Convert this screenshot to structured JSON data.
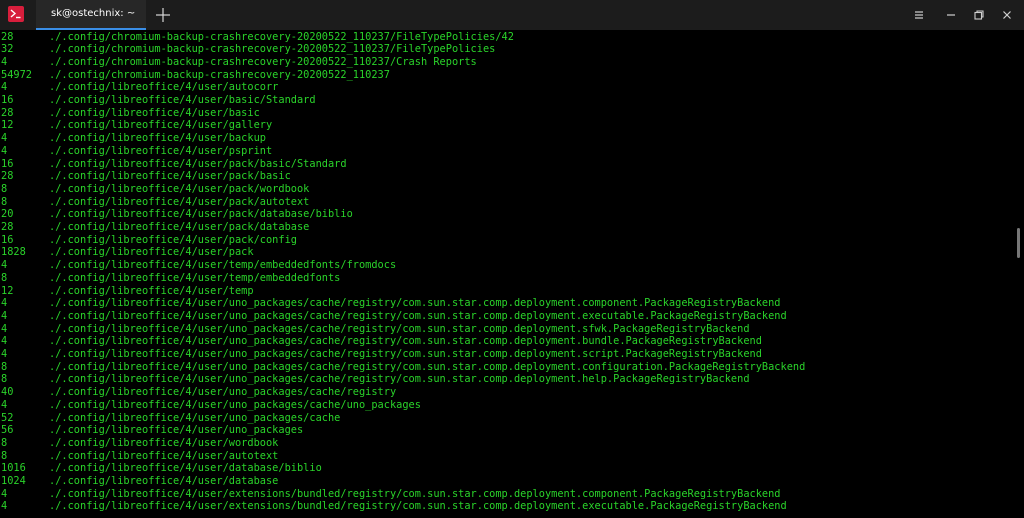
{
  "window": {
    "tab_title": "sk@ostechnix: ~",
    "icons": {
      "app": "terminal-icon",
      "new_tab": "plus-icon",
      "menu": "hamburger-menu-icon",
      "minimize": "minimize-icon",
      "maximize": "maximize-icon",
      "close": "close-icon"
    },
    "colors": {
      "titlebar": "#1c1c1c",
      "tab_active": "#272727",
      "tab_accent": "#3a8ee6",
      "app_icon": "#d71e3c",
      "terminal_bg": "#000000",
      "terminal_text": "#2ad32a"
    }
  },
  "terminal": {
    "lines": [
      {
        "size": "28",
        "path": "./.config/chromium-backup-crashrecovery-20200522_110237/FileTypePolicies/42"
      },
      {
        "size": "32",
        "path": "./.config/chromium-backup-crashrecovery-20200522_110237/FileTypePolicies"
      },
      {
        "size": "4",
        "path": "./.config/chromium-backup-crashrecovery-20200522_110237/Crash Reports"
      },
      {
        "size": "54972",
        "path": "./.config/chromium-backup-crashrecovery-20200522_110237"
      },
      {
        "size": "4",
        "path": "./.config/libreoffice/4/user/autocorr"
      },
      {
        "size": "16",
        "path": "./.config/libreoffice/4/user/basic/Standard"
      },
      {
        "size": "28",
        "path": "./.config/libreoffice/4/user/basic"
      },
      {
        "size": "12",
        "path": "./.config/libreoffice/4/user/gallery"
      },
      {
        "size": "4",
        "path": "./.config/libreoffice/4/user/backup"
      },
      {
        "size": "4",
        "path": "./.config/libreoffice/4/user/psprint"
      },
      {
        "size": "16",
        "path": "./.config/libreoffice/4/user/pack/basic/Standard"
      },
      {
        "size": "28",
        "path": "./.config/libreoffice/4/user/pack/basic"
      },
      {
        "size": "8",
        "path": "./.config/libreoffice/4/user/pack/wordbook"
      },
      {
        "size": "8",
        "path": "./.config/libreoffice/4/user/pack/autotext"
      },
      {
        "size": "20",
        "path": "./.config/libreoffice/4/user/pack/database/biblio"
      },
      {
        "size": "28",
        "path": "./.config/libreoffice/4/user/pack/database"
      },
      {
        "size": "16",
        "path": "./.config/libreoffice/4/user/pack/config"
      },
      {
        "size": "1828",
        "path": "./.config/libreoffice/4/user/pack"
      },
      {
        "size": "4",
        "path": "./.config/libreoffice/4/user/temp/embeddedfonts/fromdocs"
      },
      {
        "size": "8",
        "path": "./.config/libreoffice/4/user/temp/embeddedfonts"
      },
      {
        "size": "12",
        "path": "./.config/libreoffice/4/user/temp"
      },
      {
        "size": "4",
        "path": "./.config/libreoffice/4/user/uno_packages/cache/registry/com.sun.star.comp.deployment.component.PackageRegistryBackend"
      },
      {
        "size": "4",
        "path": "./.config/libreoffice/4/user/uno_packages/cache/registry/com.sun.star.comp.deployment.executable.PackageRegistryBackend"
      },
      {
        "size": "4",
        "path": "./.config/libreoffice/4/user/uno_packages/cache/registry/com.sun.star.comp.deployment.sfwk.PackageRegistryBackend"
      },
      {
        "size": "4",
        "path": "./.config/libreoffice/4/user/uno_packages/cache/registry/com.sun.star.comp.deployment.bundle.PackageRegistryBackend"
      },
      {
        "size": "4",
        "path": "./.config/libreoffice/4/user/uno_packages/cache/registry/com.sun.star.comp.deployment.script.PackageRegistryBackend"
      },
      {
        "size": "8",
        "path": "./.config/libreoffice/4/user/uno_packages/cache/registry/com.sun.star.comp.deployment.configuration.PackageRegistryBackend"
      },
      {
        "size": "8",
        "path": "./.config/libreoffice/4/user/uno_packages/cache/registry/com.sun.star.comp.deployment.help.PackageRegistryBackend"
      },
      {
        "size": "40",
        "path": "./.config/libreoffice/4/user/uno_packages/cache/registry"
      },
      {
        "size": "4",
        "path": "./.config/libreoffice/4/user/uno_packages/cache/uno_packages"
      },
      {
        "size": "52",
        "path": "./.config/libreoffice/4/user/uno_packages/cache"
      },
      {
        "size": "56",
        "path": "./.config/libreoffice/4/user/uno_packages"
      },
      {
        "size": "8",
        "path": "./.config/libreoffice/4/user/wordbook"
      },
      {
        "size": "8",
        "path": "./.config/libreoffice/4/user/autotext"
      },
      {
        "size": "1016",
        "path": "./.config/libreoffice/4/user/database/biblio"
      },
      {
        "size": "1024",
        "path": "./.config/libreoffice/4/user/database"
      },
      {
        "size": "4",
        "path": "./.config/libreoffice/4/user/extensions/bundled/registry/com.sun.star.comp.deployment.component.PackageRegistryBackend"
      },
      {
        "size": "4",
        "path": "./.config/libreoffice/4/user/extensions/bundled/registry/com.sun.star.comp.deployment.executable.PackageRegistryBackend"
      }
    ]
  }
}
